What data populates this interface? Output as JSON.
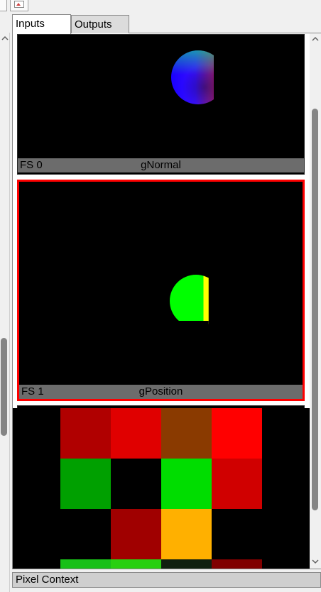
{
  "tabs": [
    {
      "label": "Inputs",
      "active": true
    },
    {
      "label": "Outputs",
      "active": false
    }
  ],
  "thumbnails": [
    {
      "slot": "FS 0",
      "name": "gNormal",
      "selected": false
    },
    {
      "slot": "FS 1",
      "name": "gPosition",
      "selected": true
    }
  ],
  "pixel_grid": {
    "rows": [
      [
        "#000000",
        "#b00000",
        "#e00000",
        "#8a3a00",
        "#ff0000",
        "#000000"
      ],
      [
        "#000000",
        "#00a000",
        "#000000",
        "#00dd00",
        "#d00000",
        "#000000"
      ],
      [
        "#000000",
        "#000000",
        "#a00000",
        "#ffb000",
        "#000000",
        "#000000"
      ],
      [
        "#000000",
        "#18c018",
        "#28d010",
        "#102010",
        "#800000",
        "#000000"
      ]
    ]
  },
  "bottom_bar": {
    "label": "Pixel Context"
  },
  "colors": {
    "selected_border": "#ff0000",
    "caption_bg": "#6c6c6c"
  },
  "icons": {
    "toolbar": "image-icon"
  }
}
